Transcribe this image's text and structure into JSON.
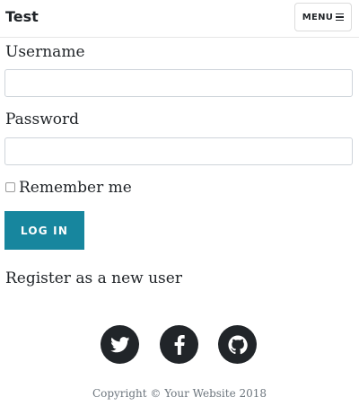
{
  "navbar": {
    "brand": "Test",
    "menu_label": "MENU"
  },
  "form": {
    "username_label": "Username",
    "username_value": "",
    "password_label": "Password",
    "password_value": "",
    "remember_label": "Remember me",
    "remember_checked": false,
    "login_label": "LOG IN",
    "login_color": "#17869e"
  },
  "register_link": "Register as a new user",
  "social": {
    "icons": [
      "twitter-icon",
      "facebook-icon",
      "github-icon"
    ],
    "color": "#212529"
  },
  "footer": {
    "copyright": "Copyright © Your Website 2018"
  }
}
